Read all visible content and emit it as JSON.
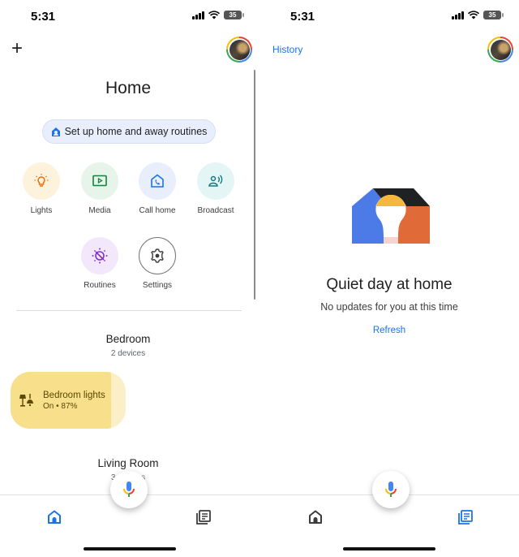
{
  "status_bar": {
    "time": "5:31",
    "battery": "35"
  },
  "left": {
    "title": "Home",
    "routine_chip": "Set up home and away routines",
    "actions": [
      {
        "label": "Lights",
        "icon": "lightbulb-icon",
        "bg": "#fdf3dc",
        "fg": "#e8710a"
      },
      {
        "label": "Media",
        "icon": "media-play-icon",
        "bg": "#e6f4ea",
        "fg": "#188038"
      },
      {
        "label": "Call home",
        "icon": "call-home-icon",
        "bg": "#e8eefc",
        "fg": "#1a73e8"
      },
      {
        "label": "Broadcast",
        "icon": "broadcast-icon",
        "bg": "#e4f5f6",
        "fg": "#137b80"
      },
      {
        "label": "Routines",
        "icon": "routines-icon",
        "bg": "#f2e7fb",
        "fg": "#8430ce"
      },
      {
        "label": "Settings",
        "icon": "gear-icon",
        "bg": "#ffffff",
        "fg": "#3c3c3c"
      }
    ],
    "rooms": [
      {
        "name": "Bedroom",
        "devices": "2 devices"
      },
      {
        "name": "Living Room",
        "devices": "3 devices"
      }
    ],
    "device": {
      "name": "Bedroom lights",
      "status": "On • 87%",
      "brightness_percent": 87
    }
  },
  "right": {
    "history_label": "History",
    "empty_title": "Quiet day at home",
    "empty_subtitle": "No updates for you at this time",
    "refresh_label": "Refresh"
  },
  "nav": {
    "active_color": "#1a73e8",
    "inactive_color": "#3c3c3c"
  }
}
